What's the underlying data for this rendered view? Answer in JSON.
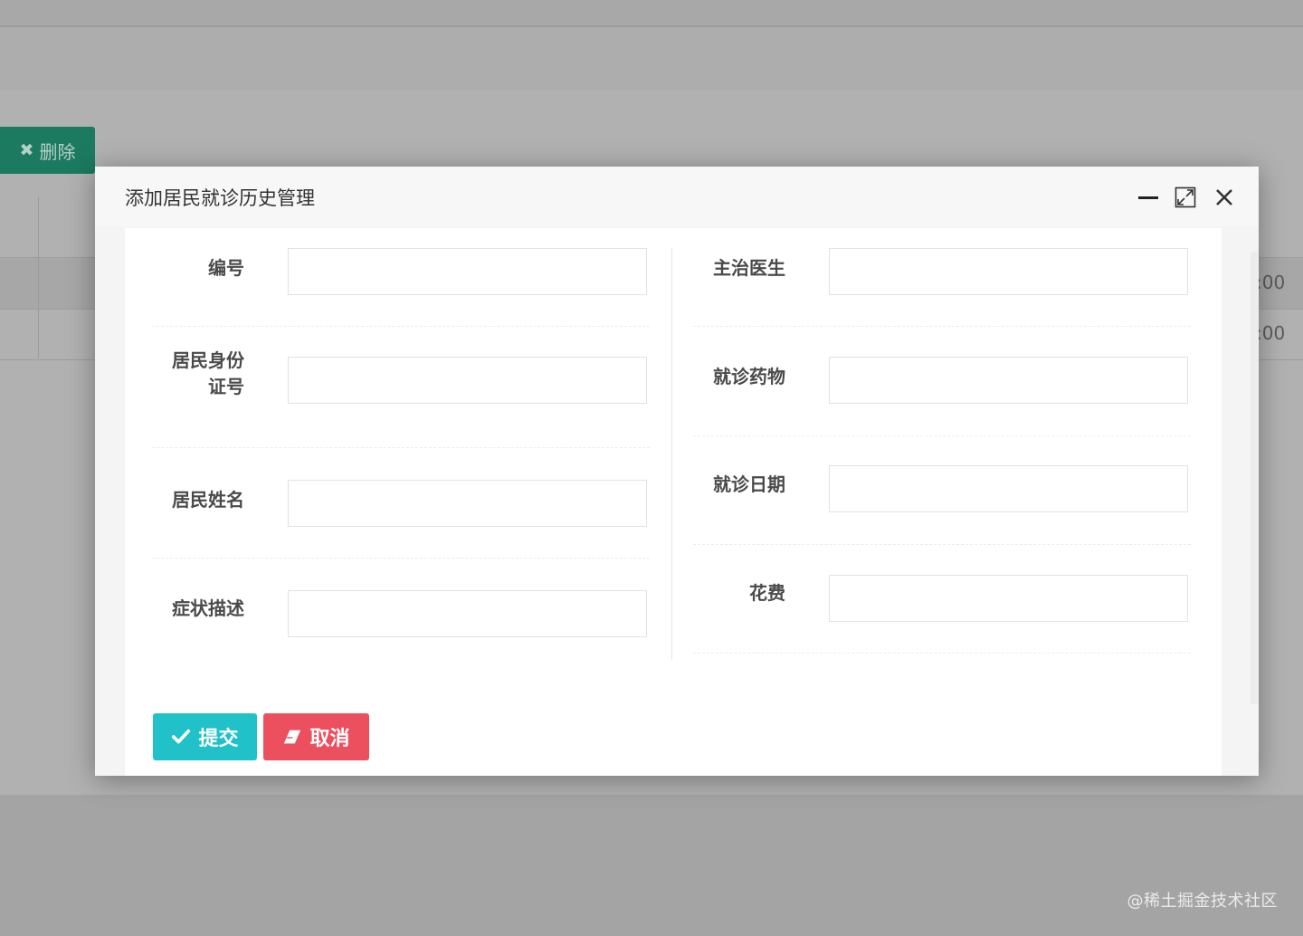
{
  "background": {
    "delete_button": {
      "icon": "close-x-icon",
      "label": "删除"
    },
    "time_cells": [
      ":00",
      ":00"
    ]
  },
  "dialog": {
    "title": "添加居民就诊历史管理",
    "controls": [
      "minimize-icon",
      "maximize-icon",
      "close-icon"
    ],
    "left_fields": [
      {
        "label": "编号",
        "value": ""
      },
      {
        "label": "居民身份证号",
        "label_line1": "居民身份",
        "label_line2": "证号",
        "value": ""
      },
      {
        "label": "居民姓名",
        "value": ""
      },
      {
        "label": "症状描述",
        "value": ""
      }
    ],
    "right_fields": [
      {
        "label": "主治医生",
        "value": ""
      },
      {
        "label": "就诊药物",
        "value": ""
      },
      {
        "label": "就诊日期",
        "value": ""
      },
      {
        "label": "花费",
        "value": ""
      }
    ],
    "submit_button": {
      "icon": "check-icon",
      "label": "提交",
      "color": "#20c1c9"
    },
    "cancel_button": {
      "icon": "eraser-icon",
      "label": "取消",
      "color": "#ec4f5e"
    }
  },
  "watermark": "@稀土掘金技术社区"
}
